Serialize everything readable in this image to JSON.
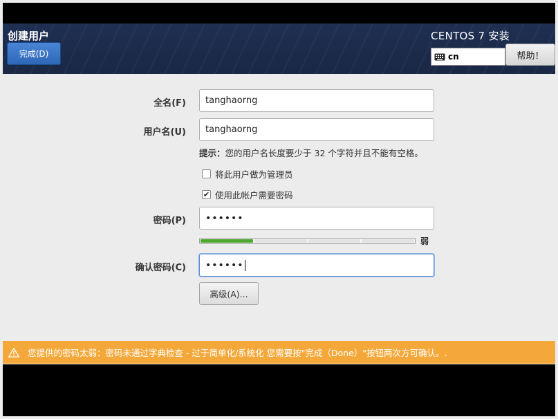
{
  "header": {
    "title": "创建用户",
    "done_label": "完成(D)",
    "product": "CENTOS 7 安装",
    "keyboard_layout": "cn",
    "keyboard_icon": "keyboard-icon",
    "help_label": "帮助！"
  },
  "form": {
    "fullname_label": "全名(F)",
    "fullname_value": "tanghaorng",
    "username_label": "用户名(U)",
    "username_value": "tanghaorng",
    "hint_prefix": "提示：",
    "hint_text": "您的用户名长度要少于 32 个字符并且不能有空格。",
    "admin_label": "将此用户做为管理员",
    "admin_checked": false,
    "require_pw_label": "使用此帐户需要密码",
    "require_pw_checked": true,
    "password_label": "密码(P)",
    "password_value": "••••••",
    "strength_fraction": 0.25,
    "strength_label": "弱",
    "confirm_label": "确认密码(C)",
    "confirm_value": "••••••",
    "advanced_label": "高级(A)..."
  },
  "warning": {
    "icon": "warning-icon",
    "text": "您提供的密码太弱：密码未通过字典检查 - 过于简单化/系统化 您需要按\"完成（Done）\"按钮两次方可确认。."
  },
  "colors": {
    "header_bg": "#1e2f52",
    "primary_button": "#3a76c8",
    "warning_bar": "#f5a83a",
    "strength_weak": "#4ea72e"
  }
}
